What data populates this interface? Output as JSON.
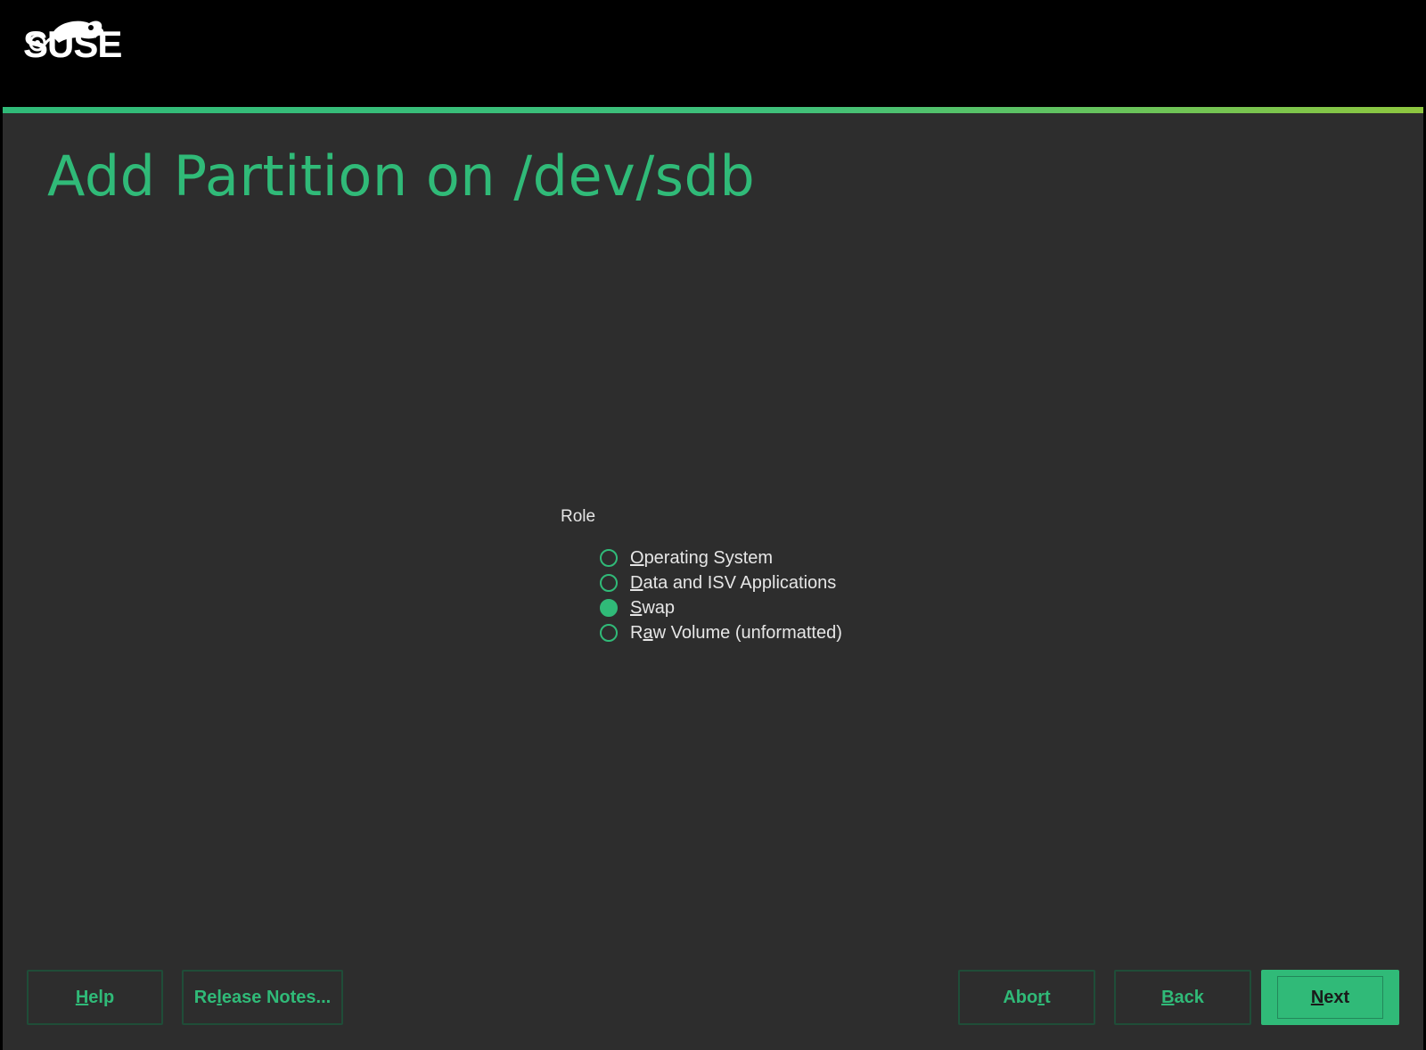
{
  "app": {
    "logo_text": "SUSE",
    "colors": {
      "accent": "#30ba78",
      "accent_secondary": "#8ec63f",
      "background": "#2d2d2d",
      "header_background": "#000000",
      "text": "#e6e6e6"
    }
  },
  "page": {
    "title": "Add Partition on /dev/sdb"
  },
  "role": {
    "label": "Role",
    "options": [
      {
        "pre": "",
        "key": "O",
        "post": "perating System",
        "selected": false
      },
      {
        "pre": "",
        "key": "D",
        "post": "ata and ISV Applications",
        "selected": false
      },
      {
        "pre": "",
        "key": "S",
        "post": "wap",
        "selected": true
      },
      {
        "pre": "R",
        "key": "a",
        "post": "w Volume (unformatted)",
        "selected": false
      }
    ]
  },
  "footer": {
    "help": {
      "pre": "",
      "key": "H",
      "post": "elp"
    },
    "release_notes": {
      "pre": "Re",
      "key": "l",
      "post": "ease Notes..."
    },
    "abort": {
      "pre": "Abo",
      "key": "r",
      "post": "t"
    },
    "back": {
      "pre": "",
      "key": "B",
      "post": "ack"
    },
    "next": {
      "pre": "",
      "key": "N",
      "post": "ext"
    }
  }
}
